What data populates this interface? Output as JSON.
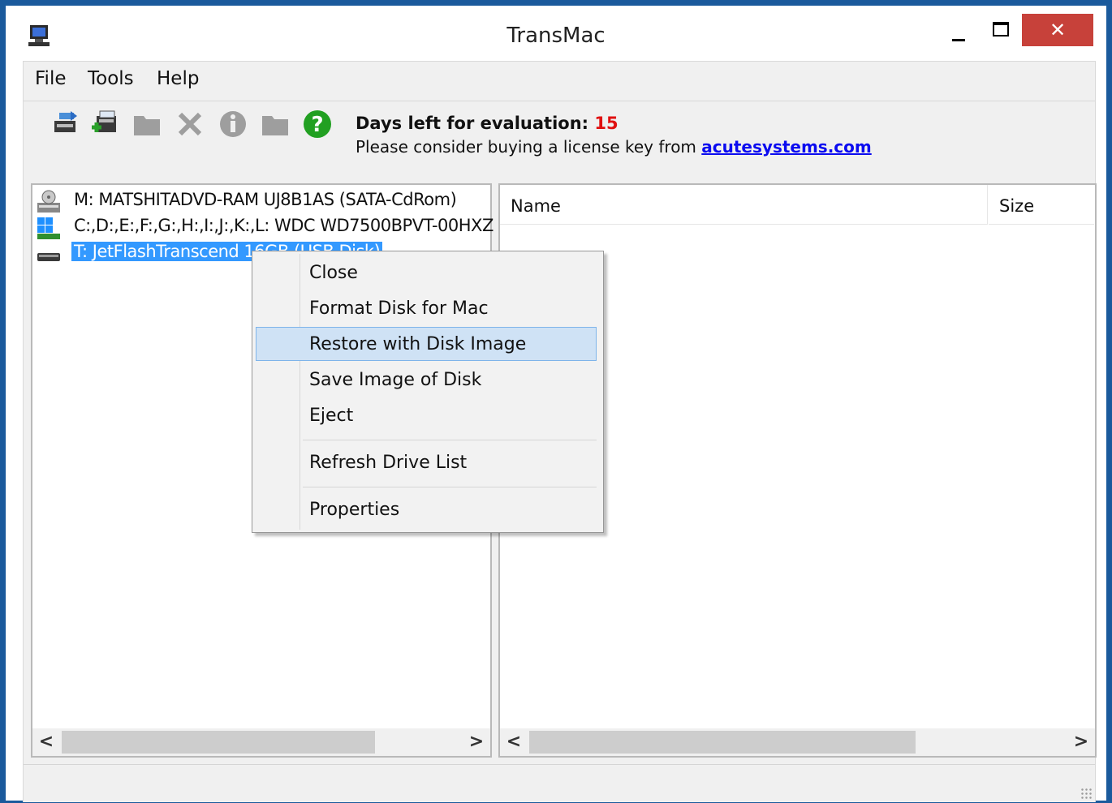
{
  "window": {
    "title": "TransMac"
  },
  "window_controls": {
    "close_label": "✕"
  },
  "menubar": {
    "file": "File",
    "tools": "Tools",
    "help": "Help"
  },
  "toolbar": {
    "icons": [
      "open-disk-image-icon",
      "new-disk-image-icon",
      "folder-icon",
      "delete-icon",
      "info-icon",
      "new-folder-icon",
      "help-icon"
    ],
    "eval_prefix": "Days left for evaluation:",
    "eval_days": "15",
    "license_text": "Please consider buying a license key from",
    "license_link": "acutesystems.com"
  },
  "drives": [
    {
      "label": "M: MATSHITADVD-RAM UJ8B1AS (SATA-CdRom)",
      "icon": "cdrom-drive-icon"
    },
    {
      "label": "C:,D:,E:,F:,G:,H:,I:,J:,K:,L: WDC WD7500BPVT-00HXZ",
      "icon": "hard-drive-icon"
    },
    {
      "label": "T: JetFlashTranscend 16GB (USB Disk)",
      "icon": "usb-drive-icon",
      "selected": true
    }
  ],
  "file_list": {
    "columns": [
      "Name",
      "Size"
    ]
  },
  "scrollbars": {
    "left_arrow": "<",
    "right_arrow": ">"
  },
  "context_menu": {
    "items": [
      {
        "label": "Close"
      },
      {
        "label": "Format Disk for Mac"
      },
      {
        "label": "Restore with Disk Image",
        "highlighted": true
      },
      {
        "label": "Save Image of Disk"
      },
      {
        "label": "Eject"
      },
      {
        "label": "Refresh Drive List"
      },
      {
        "label": "Properties"
      }
    ]
  },
  "colors": {
    "accent": "#3399ff",
    "title_border": "#1a5a9c",
    "close_button": "#c7413a",
    "eval_days": "#e01010",
    "link": "#0b0bf0"
  }
}
